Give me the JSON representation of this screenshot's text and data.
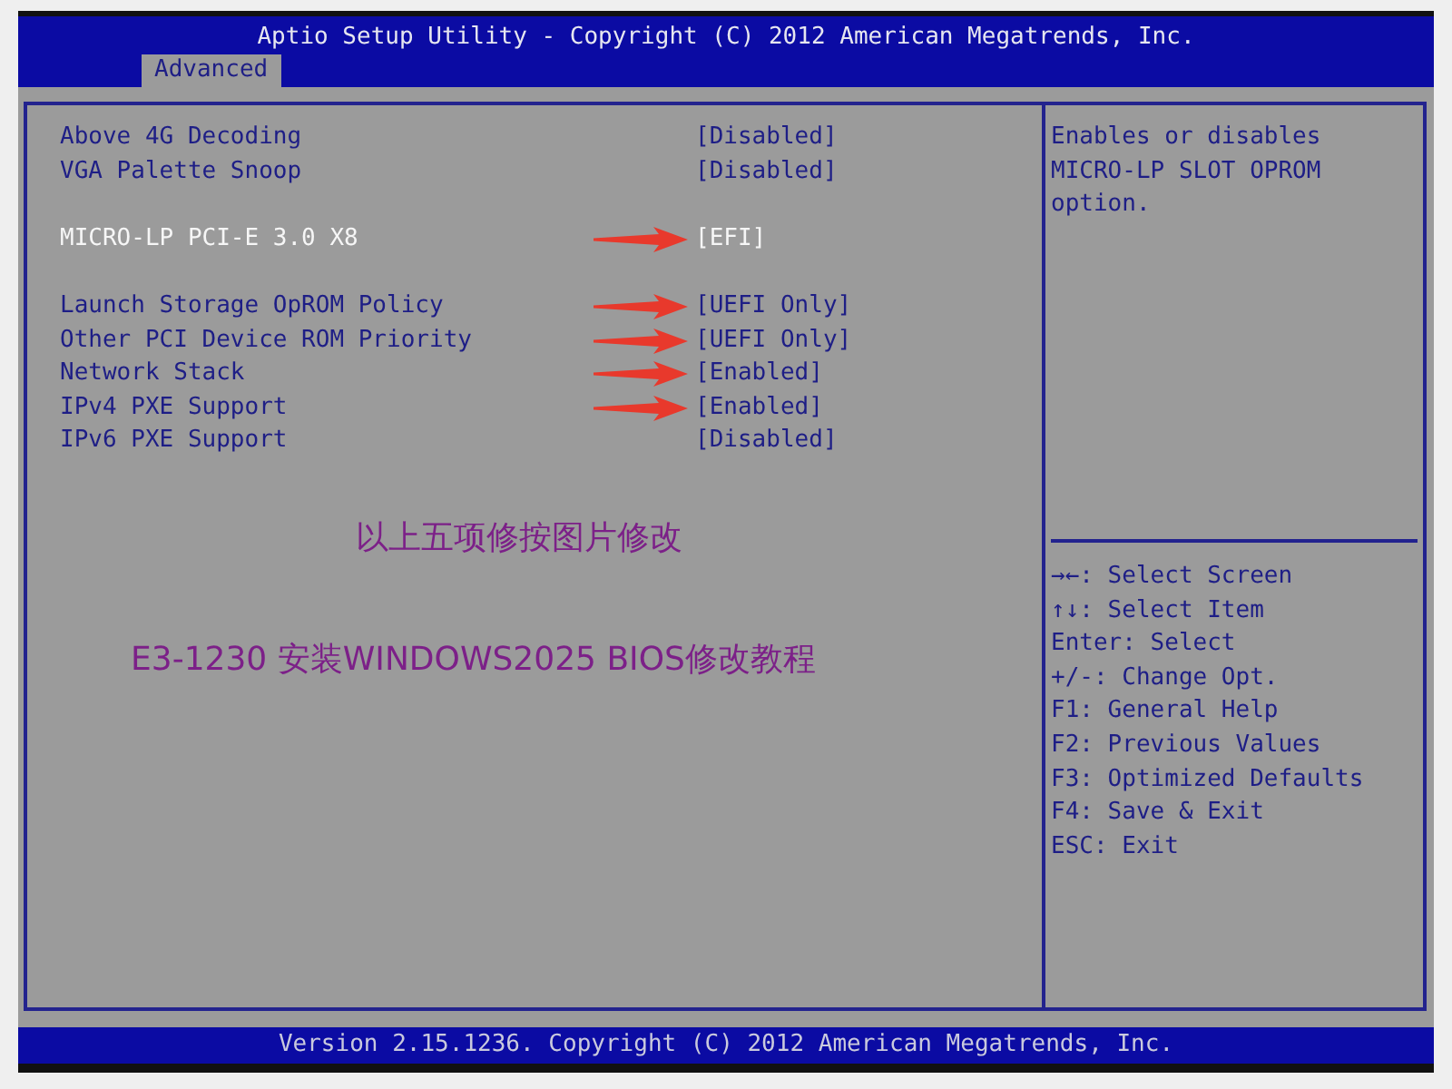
{
  "header": {
    "title": "Aptio Setup Utility - Copyright (C) 2012 American Megatrends, Inc."
  },
  "tabs": [
    {
      "label": "Advanced",
      "selected": true
    }
  ],
  "sections": [
    {
      "items": [
        {
          "label": "Above 4G Decoding",
          "value": "[Disabled]",
          "selected": false,
          "marked": false
        },
        {
          "label": "VGA Palette Snoop",
          "value": "[Disabled]",
          "selected": false,
          "marked": false
        }
      ]
    },
    {
      "items": [
        {
          "label": "MICRO-LP PCI-E 3.0 X8",
          "value": "[EFI]",
          "selected": true,
          "marked": true
        }
      ]
    },
    {
      "items": [
        {
          "label": "Launch Storage OpROM Policy",
          "value": "[UEFI Only]",
          "selected": false,
          "marked": true
        },
        {
          "label": "Other PCI Device ROM Priority",
          "value": "[UEFI Only]",
          "selected": false,
          "marked": true
        },
        {
          "label": "Network Stack",
          "value": "[Enabled]",
          "selected": false,
          "marked": true
        },
        {
          "label": "IPv4 PXE Support",
          "value": "[Enabled]",
          "selected": false,
          "marked": true
        },
        {
          "label": "IPv6 PXE Support",
          "value": "[Disabled]",
          "selected": false,
          "marked": false
        }
      ]
    }
  ],
  "annotations": [
    {
      "text": "以上五项修按图片修改"
    },
    {
      "text": "E3-1230 安装WINDOWS2025 BIOS修改教程"
    }
  ],
  "help": {
    "description": "Enables or disables MICRO-LP SLOT OPROM option.",
    "keys": [
      "→←: Select Screen",
      "↑↓: Select Item",
      "Enter: Select",
      "+/-: Change Opt.",
      "F1: General Help",
      "F2: Previous Values",
      "F3: Optimized Defaults",
      "F4: Save & Exit",
      "ESC: Exit"
    ]
  },
  "footer": {
    "text": "Version 2.15.1236. Copyright (C) 2012 American Megatrends, Inc."
  }
}
